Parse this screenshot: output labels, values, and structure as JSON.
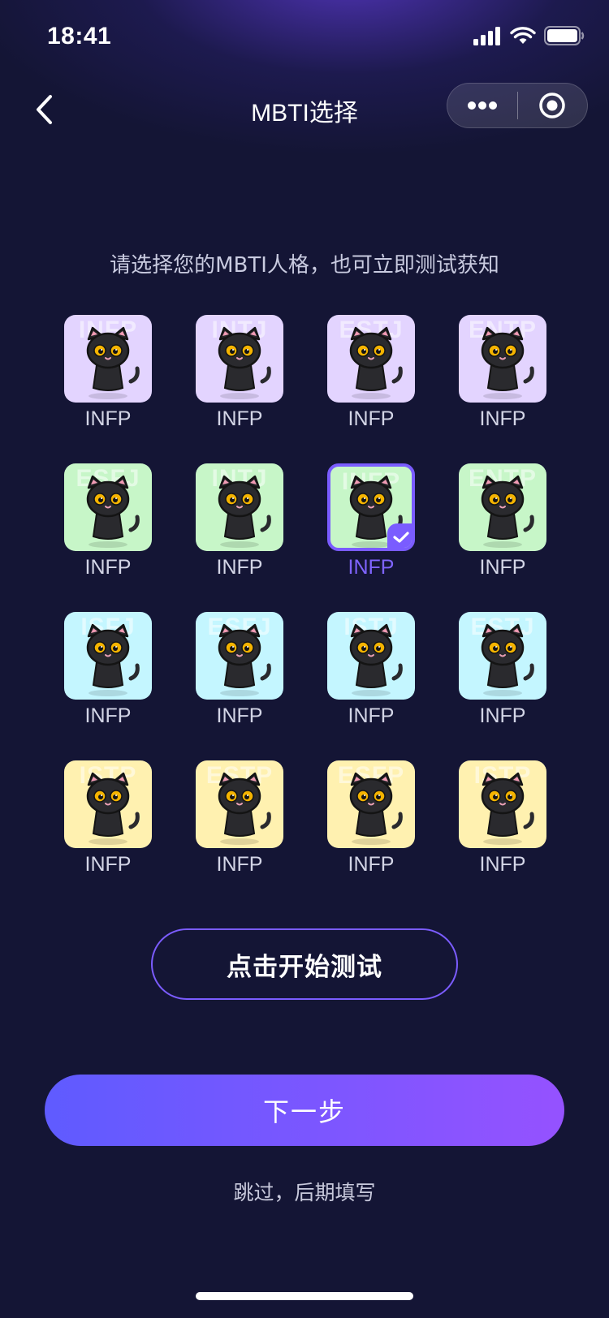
{
  "status": {
    "time": "18:41"
  },
  "nav": {
    "title": "MBTI选择"
  },
  "subtitle": "请选择您的MBTI人格，也可立即测试获知",
  "colors": {
    "purple": "#e3d4ff",
    "green": "#c7f6c8",
    "cyan": "#c4f6ff",
    "yellow": "#fff1b0",
    "accent": "#7a5cff"
  },
  "grid": {
    "rows": [
      {
        "theme": "purple",
        "items": [
          {
            "label": "INFP",
            "watermark": "INFP",
            "icon": "cat-scientist-icon"
          },
          {
            "label": "INFP",
            "watermark": "INTJ",
            "icon": "cat-chess-icon"
          },
          {
            "label": "INFP",
            "watermark": "ESTJ",
            "icon": "cat-knight-icon"
          },
          {
            "label": "INFP",
            "watermark": "ENTP",
            "icon": "cat-bowtie-icon"
          }
        ]
      },
      {
        "theme": "green",
        "items": [
          {
            "label": "INFP",
            "watermark": "ESFJ",
            "icon": "cat-crown-icon"
          },
          {
            "label": "INFP",
            "watermark": "INTJ",
            "icon": "cat-hooded-icon"
          },
          {
            "label": "INFP",
            "watermark": "INFP",
            "icon": "cat-leaf-icon",
            "selected": true
          },
          {
            "label": "INFP",
            "watermark": "ENTP",
            "icon": "cat-money-icon"
          }
        ]
      },
      {
        "theme": "cyan",
        "items": [
          {
            "label": "INFP",
            "watermark": "ISFJ",
            "icon": "cat-nurse-icon"
          },
          {
            "label": "INFP",
            "watermark": "ESFJ",
            "icon": "cat-umbrella-icon"
          },
          {
            "label": "INFP",
            "watermark": "ISTJ",
            "icon": "cat-notebook-icon"
          },
          {
            "label": "INFP",
            "watermark": "ESTJ",
            "icon": "cat-suit-icon"
          }
        ]
      },
      {
        "theme": "yellow",
        "items": [
          {
            "label": "INFP",
            "watermark": "ISTP",
            "icon": "cat-builder-icon"
          },
          {
            "label": "INFP",
            "watermark": "ESTP",
            "icon": "cat-drink-icon"
          },
          {
            "label": "INFP",
            "watermark": "ESFP",
            "icon": "cat-singer-icon"
          },
          {
            "label": "INFP",
            "watermark": "ISTP",
            "icon": "cat-painter-icon"
          }
        ]
      }
    ]
  },
  "actions": {
    "test_label": "点击开始测试",
    "next_label": "下一步",
    "skip_label": "跳过，后期填写"
  }
}
